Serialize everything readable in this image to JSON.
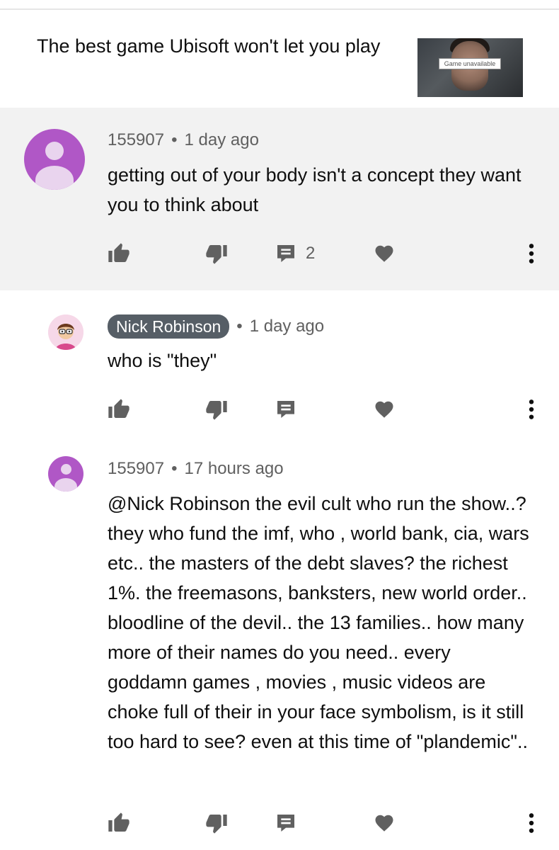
{
  "video": {
    "title": "The best game Ubisoft won't let you play",
    "thumbnail_badge": "Game unavailable",
    "thumbnail_icon": "video-thumbnail"
  },
  "comments": [
    {
      "author": "155907",
      "time": "1 day ago",
      "text": "getting out of your body isn't a concept they want you to think about",
      "reply_count": "2"
    },
    {
      "author": "Nick Robinson",
      "time": "1 day ago",
      "text": "who is \"they\""
    },
    {
      "author": "155907",
      "time": "17 hours ago",
      "text": "@Nick Robinson the evil cult who run the show..? they who fund the imf, who , world bank, cia, wars etc.. the masters of the debt slaves? the richest 1%. the freemasons, banksters, new world order.. bloodline of the devil.. the 13 families.. how many more of their names do you need..  every goddamn games , movies , music videos are choke full of their in your face symbolism, is it still too hard to see? even at this time of \"plandemic\".."
    }
  ],
  "meta_separator": "•",
  "colors": {
    "highlight_bg": "#f2f2f2",
    "icon_gray": "#606060",
    "avatar_purple": "#b057c6",
    "author_chip": "#565e66"
  },
  "icons": [
    "like-icon",
    "dislike-icon",
    "reply-icon",
    "heart-icon",
    "more-icon"
  ]
}
